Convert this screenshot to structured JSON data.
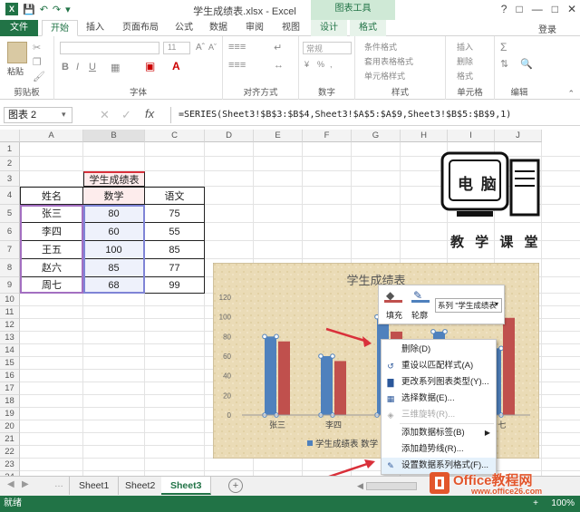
{
  "window": {
    "title": "学生成绩表.xlsx - Excel",
    "context_tools": "图表工具",
    "help": "?",
    "login": "登录"
  },
  "tabs": [
    "文件",
    "开始",
    "插入",
    "页面布局",
    "公式",
    "数据",
    "审阅",
    "视图",
    "设计",
    "格式"
  ],
  "ribbon": {
    "groups": [
      "剪贴板",
      "字体",
      "对齐方式",
      "数字",
      "样式",
      "单元格",
      "编辑"
    ],
    "paste": "粘贴",
    "font_size": "11",
    "number_format": "常规",
    "styles": [
      "条件格式",
      "套用表格格式",
      "单元格样式"
    ],
    "cells": [
      "插入",
      "删除",
      "格式"
    ],
    "number_symbols": [
      "%",
      ","
    ]
  },
  "formula_bar": {
    "name_box": "图表 2",
    "fx": "fx",
    "formula": "=SERIES(Sheet3!$B$3:$B$4,Sheet3!$A$5:$A$9,Sheet3!$B$5:$B$9,1)"
  },
  "columns": [
    "A",
    "B",
    "C",
    "D",
    "E",
    "F",
    "G",
    "H",
    "I",
    "J"
  ],
  "rows": [
    "1",
    "2",
    "3",
    "4",
    "5",
    "6",
    "7",
    "8",
    "9",
    "10",
    "11",
    "12",
    "13",
    "14",
    "15",
    "16",
    "17",
    "18",
    "19",
    "20",
    "21",
    "22",
    "23",
    "24"
  ],
  "table": {
    "header_top": "学生成绩表",
    "headers": [
      "姓名",
      "数学",
      "语文"
    ],
    "rows": [
      [
        "张三",
        "80",
        "75"
      ],
      [
        "李四",
        "60",
        "55"
      ],
      [
        "王五",
        "100",
        "85"
      ],
      [
        "赵六",
        "85",
        "77"
      ],
      [
        "周七",
        "68",
        "99"
      ]
    ]
  },
  "logo": {
    "top": "电 脑",
    "bottom": "教 学 课 堂"
  },
  "chart_data": {
    "type": "bar",
    "title": "学生成绩表",
    "categories": [
      "张三",
      "李四",
      "王五",
      "赵六",
      "周七"
    ],
    "visible_category_labels": [
      "张三",
      "李四",
      "王",
      "",
      "七"
    ],
    "series": [
      {
        "name": "学生成绩表 数学",
        "color": "#4f81bd",
        "values": [
          80,
          60,
          100,
          85,
          68
        ]
      },
      {
        "color": "#c0504d",
        "values": [
          75,
          55,
          85,
          77,
          99
        ]
      }
    ],
    "legend_text": "学生成绩表 数学",
    "ylim": [
      0,
      120
    ],
    "yticks": [
      "120",
      "100",
      "80",
      "60",
      "40",
      "20",
      "0"
    ]
  },
  "minitoolbar": {
    "fill": "填充",
    "outline": "轮廓",
    "series_select": "系列 \"学生成绩表"
  },
  "context_menu": [
    {
      "label": "删除(D)",
      "icon": "",
      "disabled": false
    },
    {
      "label": "重设以匹配样式(A)",
      "icon": "reset-icon",
      "disabled": false
    },
    {
      "label": "更改系列图表类型(Y)...",
      "icon": "chart-type-icon",
      "disabled": false
    },
    {
      "label": "选择数据(E)...",
      "icon": "select-data-icon",
      "disabled": false
    },
    {
      "label": "三维旋转(R)...",
      "icon": "rotate-3d-icon",
      "disabled": true
    },
    {
      "label": "添加数据标签(B)",
      "icon": "",
      "disabled": false
    },
    {
      "label": "添加趋势线(R)...",
      "icon": "",
      "disabled": false
    },
    {
      "label": "设置数据系列格式(F)...",
      "icon": "format-series-icon",
      "disabled": false
    }
  ],
  "sheets": [
    "Sheet1",
    "Sheet2",
    "Sheet3"
  ],
  "active_sheet": "Sheet3",
  "status": {
    "ready": "就绪",
    "zoom": "100%"
  },
  "watermark": {
    "brand": "Office教程网",
    "url": "www.office26.com"
  },
  "colors": {
    "excel_green": "#217346",
    "series1": "#4f81bd",
    "series2": "#c0504d",
    "arrow": "#d9303a"
  }
}
